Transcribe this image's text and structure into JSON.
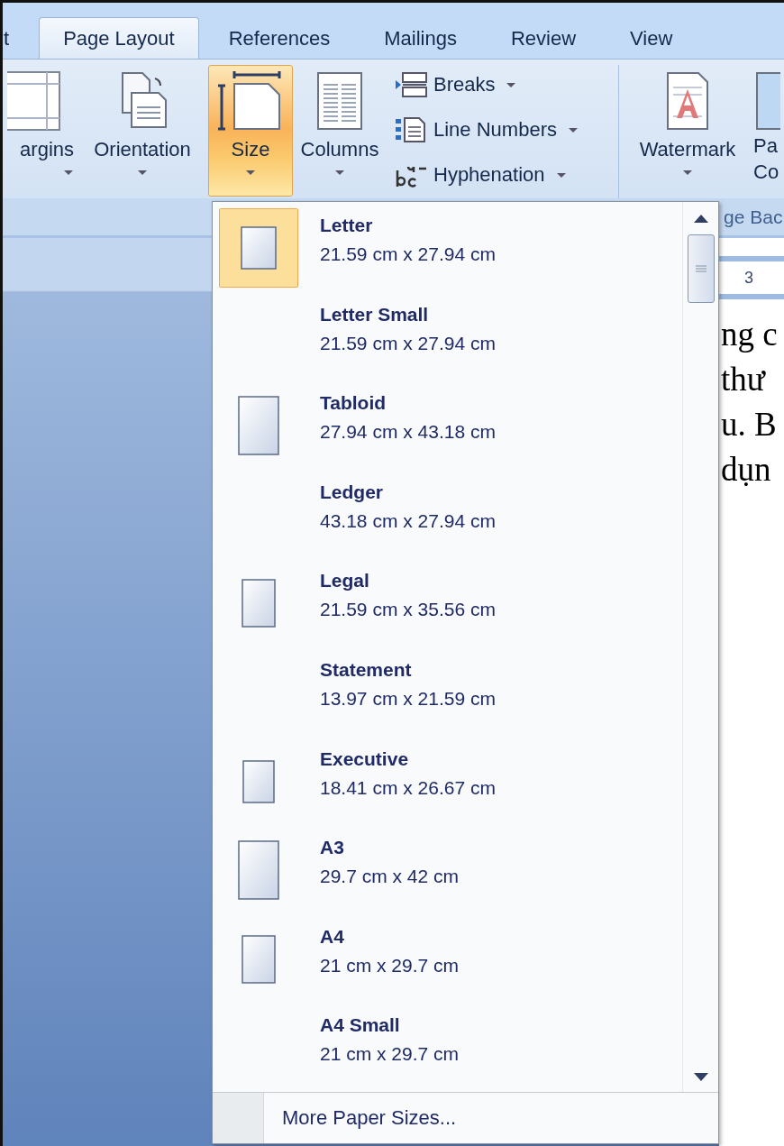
{
  "tabs": [
    {
      "label": "t",
      "selected": false
    },
    {
      "label": "Page Layout",
      "selected": true
    },
    {
      "label": "References",
      "selected": false
    },
    {
      "label": "Mailings",
      "selected": false
    },
    {
      "label": "Review",
      "selected": false
    },
    {
      "label": "View",
      "selected": false
    }
  ],
  "ribbon": {
    "large_buttons": [
      {
        "label": "argins",
        "kind": "margins",
        "active": false
      },
      {
        "label": "Orientation",
        "kind": "orientation",
        "active": false
      },
      {
        "label": "Size",
        "kind": "size",
        "active": true
      },
      {
        "label": "Columns",
        "kind": "columns",
        "active": false
      }
    ],
    "small_buttons": [
      {
        "label": "Breaks",
        "kind": "breaks"
      },
      {
        "label": "Line Numbers",
        "kind": "line_numbers"
      },
      {
        "label": "Hyphenation",
        "kind": "hyphenation"
      }
    ],
    "background_group": {
      "label": "ge Bac",
      "buttons": [
        {
          "lines": [
            "Watermark"
          ],
          "kind": "watermark"
        },
        {
          "lines": [
            "Pa",
            "Co"
          ],
          "kind": "page_color"
        }
      ]
    }
  },
  "document": {
    "ruler": "3",
    "lines": [
      "ng c",
      "thư",
      "u. B",
      "dụn"
    ]
  },
  "size_menu": {
    "items": [
      {
        "name": "Letter",
        "size": "21.59 cm x 27.94 cm",
        "kind": "medium",
        "selected": true
      },
      {
        "name": "Letter Small",
        "size": "21.59 cm x 27.94 cm",
        "kind": "blank",
        "selected": false
      },
      {
        "name": "Tabloid",
        "size": "27.94 cm x 43.18 cm",
        "kind": "large",
        "selected": false
      },
      {
        "name": "Ledger",
        "size": "43.18 cm x 27.94 cm",
        "kind": "blank",
        "selected": false
      },
      {
        "name": "Legal",
        "size": "21.59 cm x 35.56 cm",
        "kind": "tall",
        "selected": false
      },
      {
        "name": "Statement",
        "size": "13.97 cm x 21.59 cm",
        "kind": "blank",
        "selected": false
      },
      {
        "name": "Executive",
        "size": "18.41 cm x 26.67 cm",
        "kind": "small",
        "selected": false
      },
      {
        "name": "A3",
        "size": "29.7 cm x 42 cm",
        "kind": "large",
        "selected": false
      },
      {
        "name": "A4",
        "size": "21 cm x 29.7 cm",
        "kind": "tall",
        "selected": false
      },
      {
        "name": "A4 Small",
        "size": "21 cm x 29.7 cm",
        "kind": "blank",
        "selected": false
      }
    ],
    "footer": "More Paper Sizes..."
  }
}
